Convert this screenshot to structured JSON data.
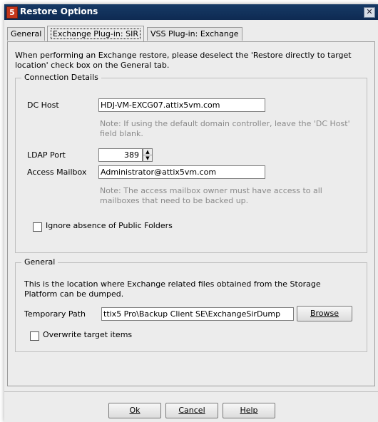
{
  "window": {
    "title": "Restore Options",
    "app_icon": "5",
    "close_glyph": "✕"
  },
  "tabs": [
    {
      "label": "General"
    },
    {
      "label": "Exchange Plug-in: SIR"
    },
    {
      "label": "VSS Plug-in: Exchange"
    }
  ],
  "intro_lines": [
    "When performing an Exchange restore, please deselect the 'Restore directly to target",
    "location' check box on the General tab."
  ],
  "connection": {
    "legend": "Connection Details",
    "dc_host_label": "DC Host",
    "dc_host_value": "HDJ-VM-EXCG07.attix5vm.com",
    "dc_note_lines": [
      "Note: If using the default domain controller, leave the 'DC Host'",
      "field blank."
    ],
    "ldap_label": "LDAP Port",
    "ldap_value": "389",
    "mailbox_label": "Access Mailbox",
    "mailbox_value": "Administrator@attix5vm.com",
    "mailbox_note_lines": [
      "Note: The access mailbox owner must have access to all",
      "mailboxes that need to be backed up."
    ],
    "ignore_label": "Ignore absence of Public Folders"
  },
  "general": {
    "legend": "General",
    "desc_lines": [
      "This is the location where Exchange related files obtained from the Storage",
      "Platform can be dumped."
    ],
    "temp_path_label": "Temporary Path",
    "temp_path_value": "ttix5 Pro\\Backup Client SE\\ExchangeSirDump",
    "browse_label": "Browse",
    "overwrite_label": "Overwrite target items"
  },
  "footer": {
    "ok": "Ok",
    "cancel": "Cancel",
    "help": "Help"
  }
}
